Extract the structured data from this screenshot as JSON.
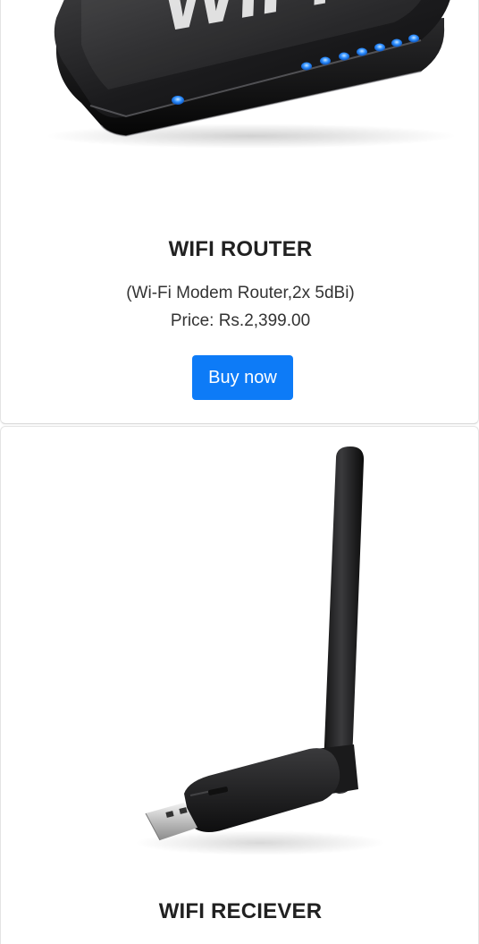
{
  "products": [
    {
      "image_icon": "wifi-router-image",
      "image_text": "WiFi",
      "title": "WIFI ROUTER",
      "description": "(Wi-Fi Modem Router,2x 5dBi)",
      "price": "Price: Rs.2,399.00",
      "button_label": "Buy now"
    },
    {
      "image_icon": "wifi-usb-receiver-image",
      "title": "WIFI RECIEVER"
    }
  ],
  "colors": {
    "button_bg": "#0d7bf7",
    "button_text": "#ffffff",
    "title_text": "#212121",
    "body_text": "#333333"
  }
}
